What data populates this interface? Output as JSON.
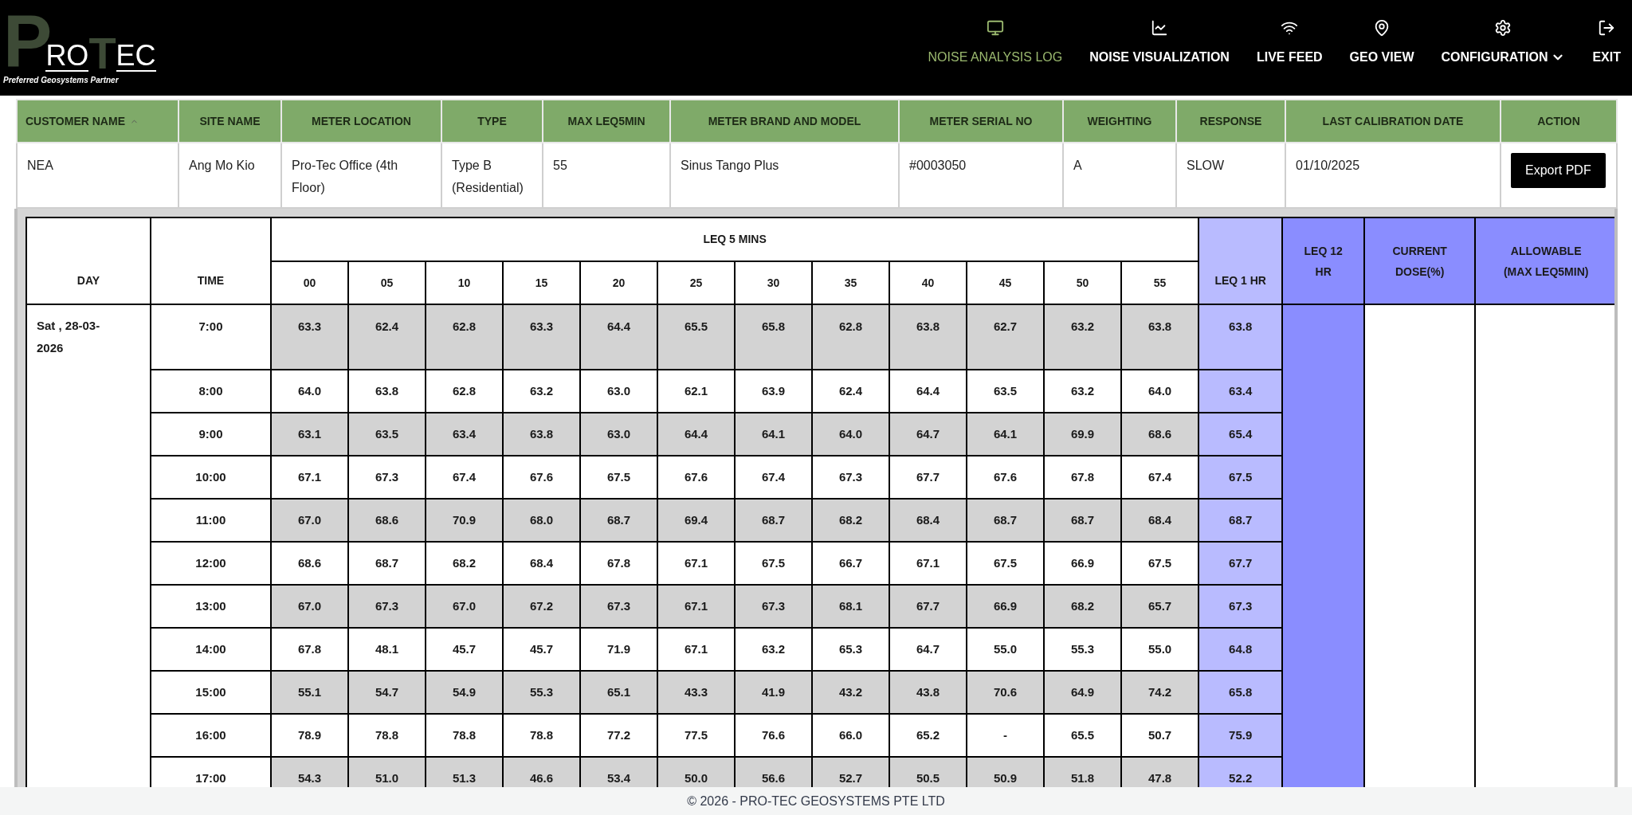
{
  "logo": {
    "letters": [
      "P",
      "RO",
      "T",
      "EC"
    ],
    "tagline": "Preferred Geosystems Partner"
  },
  "nav": [
    {
      "label": "NOISE ANALYSIS LOG",
      "selected": true,
      "dropdown": false
    },
    {
      "label": "NOISE VISUALIZATION",
      "selected": false,
      "dropdown": false
    },
    {
      "label": "LIVE FEED",
      "selected": false,
      "dropdown": false
    },
    {
      "label": "GEO VIEW",
      "selected": false,
      "dropdown": false
    },
    {
      "label": "CONFIGURATION",
      "selected": false,
      "dropdown": true
    },
    {
      "label": "EXIT",
      "selected": false,
      "dropdown": false
    }
  ],
  "info_table": {
    "columns": [
      {
        "label": "CUSTOMER NAME",
        "sortable": true
      },
      {
        "label": "SITE NAME",
        "sortable": false
      },
      {
        "label": "METER LOCATION",
        "sortable": false
      },
      {
        "label": "TYPE",
        "sortable": false
      },
      {
        "label": "MAX LEQ5MIN",
        "sortable": false
      },
      {
        "label": "METER BRAND AND MODEL",
        "sortable": false
      },
      {
        "label": "METER SERIAL NO",
        "sortable": false
      },
      {
        "label": "WEIGHTING",
        "sortable": false
      },
      {
        "label": "RESPONSE",
        "sortable": false
      },
      {
        "label": "LAST CALIBRATION DATE",
        "sortable": false
      },
      {
        "label": "ACTION",
        "sortable": false
      }
    ],
    "row": [
      "NEA",
      "Ang Mo Kio",
      "Pro-Tec Office (4th Floor)",
      "Type B (Residential)",
      "55",
      "Sinus Tango Plus",
      "#0003050",
      "A",
      "SLOW",
      "01/10/2025"
    ],
    "action": "Export PDF"
  },
  "log_table": {
    "day_header": "DAY",
    "time_header": "TIME",
    "group_header": "LEQ 5 MINS",
    "minutes": [
      "00",
      "05",
      "10",
      "15",
      "20",
      "25",
      "30",
      "35",
      "40",
      "45",
      "50",
      "55"
    ],
    "leq_1hr_header": "LEQ 1 HR",
    "leq_12hr_header": "LEQ 12 HR",
    "dose_header": "CURRENT DOSE(%)",
    "allowable_header": "ALLOWABLE (MAX LEQ5MIN)",
    "day": "Sat , 28-03-2026",
    "rows": [
      {
        "time": "7:00",
        "shaded": true,
        "values": [
          "63.3",
          "62.4",
          "62.8",
          "63.3",
          "64.4",
          "65.5",
          "65.8",
          "62.8",
          "63.8",
          "62.7",
          "63.2",
          "63.8"
        ],
        "leq_1hr": "63.8"
      },
      {
        "time": "8:00",
        "shaded": false,
        "values": [
          "64.0",
          "63.8",
          "62.8",
          "63.2",
          "63.0",
          "62.1",
          "63.9",
          "62.4",
          "64.4",
          "63.5",
          "63.2",
          "64.0"
        ],
        "leq_1hr": "63.4"
      },
      {
        "time": "9:00",
        "shaded": true,
        "values": [
          "63.1",
          "63.5",
          "63.4",
          "63.8",
          "63.0",
          "64.4",
          "64.1",
          "64.0",
          "64.7",
          "64.1",
          "69.9",
          "68.6"
        ],
        "leq_1hr": "65.4"
      },
      {
        "time": "10:00",
        "shaded": false,
        "values": [
          "67.1",
          "67.3",
          "67.4",
          "67.6",
          "67.5",
          "67.6",
          "67.4",
          "67.3",
          "67.7",
          "67.6",
          "67.8",
          "67.4"
        ],
        "leq_1hr": "67.5"
      },
      {
        "time": "11:00",
        "shaded": true,
        "values": [
          "67.0",
          "68.6",
          "70.9",
          "68.0",
          "68.7",
          "69.4",
          "68.7",
          "68.2",
          "68.4",
          "68.7",
          "68.7",
          "68.4"
        ],
        "leq_1hr": "68.7"
      },
      {
        "time": "12:00",
        "shaded": false,
        "values": [
          "68.6",
          "68.7",
          "68.2",
          "68.4",
          "67.8",
          "67.1",
          "67.5",
          "66.7",
          "67.1",
          "67.5",
          "66.9",
          "67.5"
        ],
        "leq_1hr": "67.7"
      },
      {
        "time": "13:00",
        "shaded": true,
        "values": [
          "67.0",
          "67.3",
          "67.0",
          "67.2",
          "67.3",
          "67.1",
          "67.3",
          "68.1",
          "67.7",
          "66.9",
          "68.2",
          "65.7"
        ],
        "leq_1hr": "67.3"
      },
      {
        "time": "14:00",
        "shaded": false,
        "values": [
          "67.8",
          "48.1",
          "45.7",
          "45.7",
          "71.9",
          "67.1",
          "63.2",
          "65.3",
          "64.7",
          "55.0",
          "55.3",
          "55.0"
        ],
        "leq_1hr": "64.8"
      },
      {
        "time": "15:00",
        "shaded": true,
        "values": [
          "55.1",
          "54.7",
          "54.9",
          "55.3",
          "65.1",
          "43.3",
          "41.9",
          "43.2",
          "43.8",
          "70.6",
          "64.9",
          "74.2"
        ],
        "leq_1hr": "65.8"
      },
      {
        "time": "16:00",
        "shaded": false,
        "values": [
          "78.9",
          "78.8",
          "78.8",
          "78.8",
          "77.2",
          "77.5",
          "76.6",
          "66.0",
          "65.2",
          "-",
          "65.5",
          "50.7"
        ],
        "leq_1hr": "75.9"
      },
      {
        "time": "17:00",
        "shaded": true,
        "values": [
          "54.3",
          "51.0",
          "51.3",
          "46.6",
          "53.4",
          "50.0",
          "56.6",
          "52.7",
          "50.5",
          "50.9",
          "51.8",
          "47.8"
        ],
        "leq_1hr": "52.2"
      }
    ]
  },
  "footer": "© 2026 - PRO-TEC GEOSYSTEMS PTE LTD"
}
